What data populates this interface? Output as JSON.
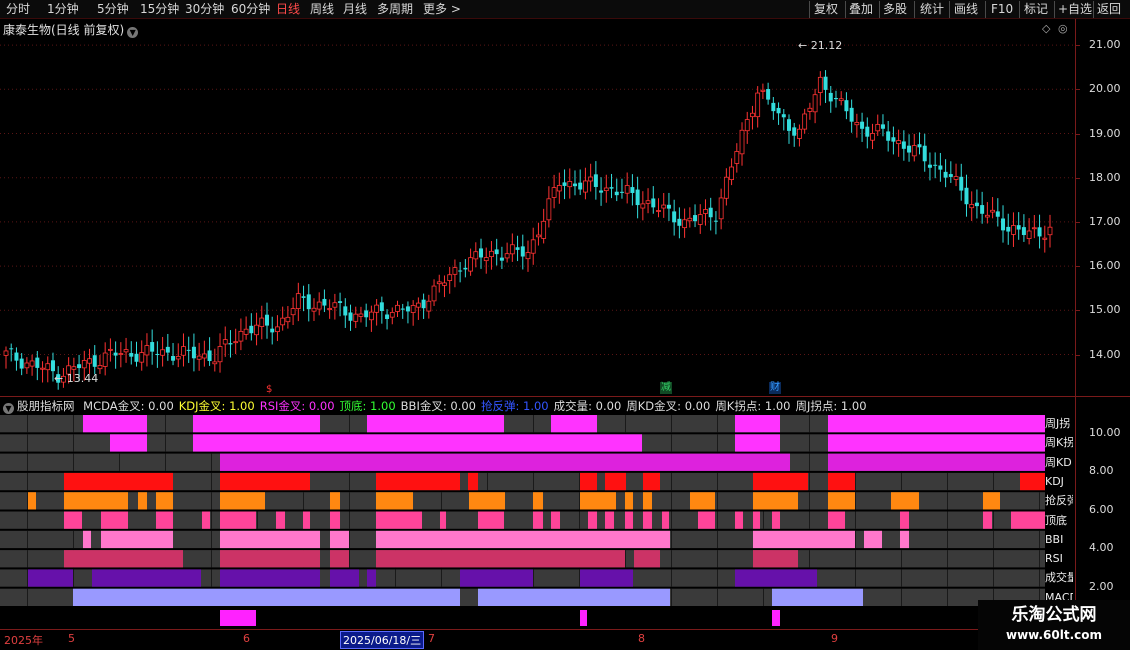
{
  "toolbar": {
    "left_tabs": [
      "分时",
      "1分钟",
      "5分钟",
      "15分钟",
      "30分钟",
      "60分钟",
      "日线",
      "周线",
      "月线",
      "多周期",
      "更多 >"
    ],
    "active_tab": "日线",
    "right_buttons": [
      "复权",
      "叠加",
      "多股",
      "统计",
      "画线",
      "F10",
      "标记",
      "+自选",
      "返回"
    ]
  },
  "stock": {
    "title": "康泰生物(日线 前复权)",
    "high_label": "21.12",
    "low_label": "13.44"
  },
  "price_axis": [
    "21.00",
    "20.00",
    "19.00",
    "18.00",
    "17.00",
    "16.00",
    "15.00",
    "14.00"
  ],
  "indicator": {
    "name": "股朋指标网",
    "items": [
      {
        "text": "MCDA金叉: 0.00",
        "color": "#dddddd"
      },
      {
        "text": "KDJ金叉: 1.00",
        "color": "#ffff33"
      },
      {
        "text": "RSI金叉: 0.00",
        "color": "#ff33ff"
      },
      {
        "text": "顶底: 1.00",
        "color": "#33ff33"
      },
      {
        "text": "BBI金叉: 0.00",
        "color": "#dddddd"
      },
      {
        "text": "抢反弹: 1.00",
        "color": "#3355ff"
      },
      {
        "text": "成交量: 0.00",
        "color": "#dddddd"
      },
      {
        "text": "周KD金叉: 0.00",
        "color": "#dddddd"
      },
      {
        "text": "周K拐点: 1.00",
        "color": "#dddddd"
      },
      {
        "text": "周J拐点: 1.00",
        "color": "#dddddd"
      }
    ],
    "row_labels": [
      "周J拐",
      "周K拐",
      "周KD",
      "KDJ",
      "抢反弹",
      "顶底",
      "BBI",
      "RSI",
      "成交量",
      "MACD"
    ],
    "axis": [
      "10.00",
      "8.00",
      "6.00",
      "4.00",
      "2.00"
    ]
  },
  "markers": [
    {
      "text": "$",
      "color": "#ff3333"
    },
    {
      "text": "减",
      "color": "#33cc66"
    },
    {
      "text": "财",
      "color": "#3399ff"
    }
  ],
  "dates": {
    "year": "2025年",
    "months": [
      "5",
      "6",
      "7",
      "8",
      "9"
    ],
    "selected": "2025/06/18/三"
  },
  "watermark": {
    "title": "乐淘公式网",
    "url": "www.60lt.com"
  },
  "colors": {
    "up": "#ff3333",
    "down": "#33dddd",
    "grid": "#7a1a1a",
    "active_tab": "#ff4a4a"
  }
}
